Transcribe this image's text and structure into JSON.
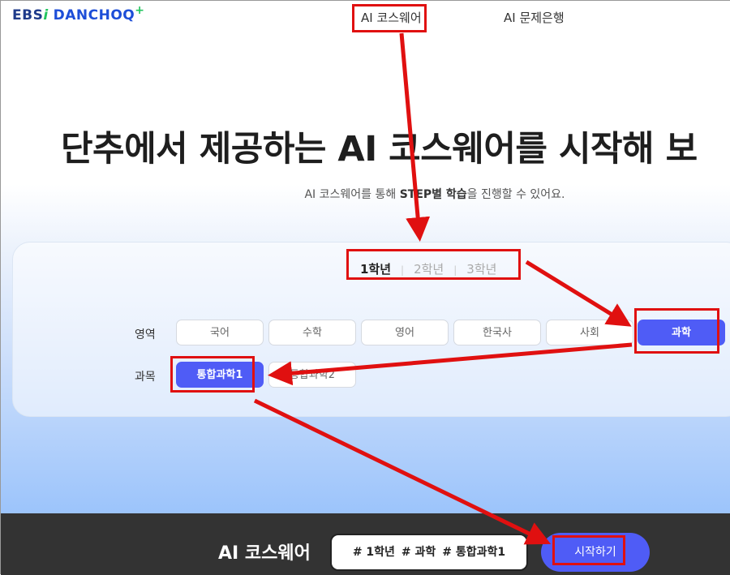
{
  "header": {
    "logo_ebs": "EBS",
    "logo_i": "i",
    "logo_danchoo": "DANCHOQ",
    "logo_plus": "+",
    "nav": [
      "AI 코스웨어",
      "AI 문제은행"
    ]
  },
  "hero": {
    "headline": "단추에서 제공하는 AI 코스웨어를 시작해 보",
    "sub_pre": "AI 코스웨어를 통해 ",
    "sub_bold": "STEP별 학습",
    "sub_post": "을 진행할 수 있어요."
  },
  "grades": [
    "1학년",
    "2학년",
    "3학년"
  ],
  "selected_grade": "1학년",
  "area_label": "영역",
  "areas": [
    "국어",
    "수학",
    "영어",
    "한국사",
    "사회",
    "과학"
  ],
  "selected_area": "과학",
  "subject_label": "과목",
  "subjects": [
    "통합과학1",
    "통합과학2"
  ],
  "selected_subject": "통합과학1",
  "footer": {
    "title": "AI 코스웨어",
    "tags": [
      "# 1학년",
      "# 과학",
      "# 통합과학1"
    ],
    "start_label": "시작하기"
  },
  "colors": {
    "accent": "#4f5cf6",
    "highlight": "#e01010",
    "footer_bg": "#333333"
  }
}
